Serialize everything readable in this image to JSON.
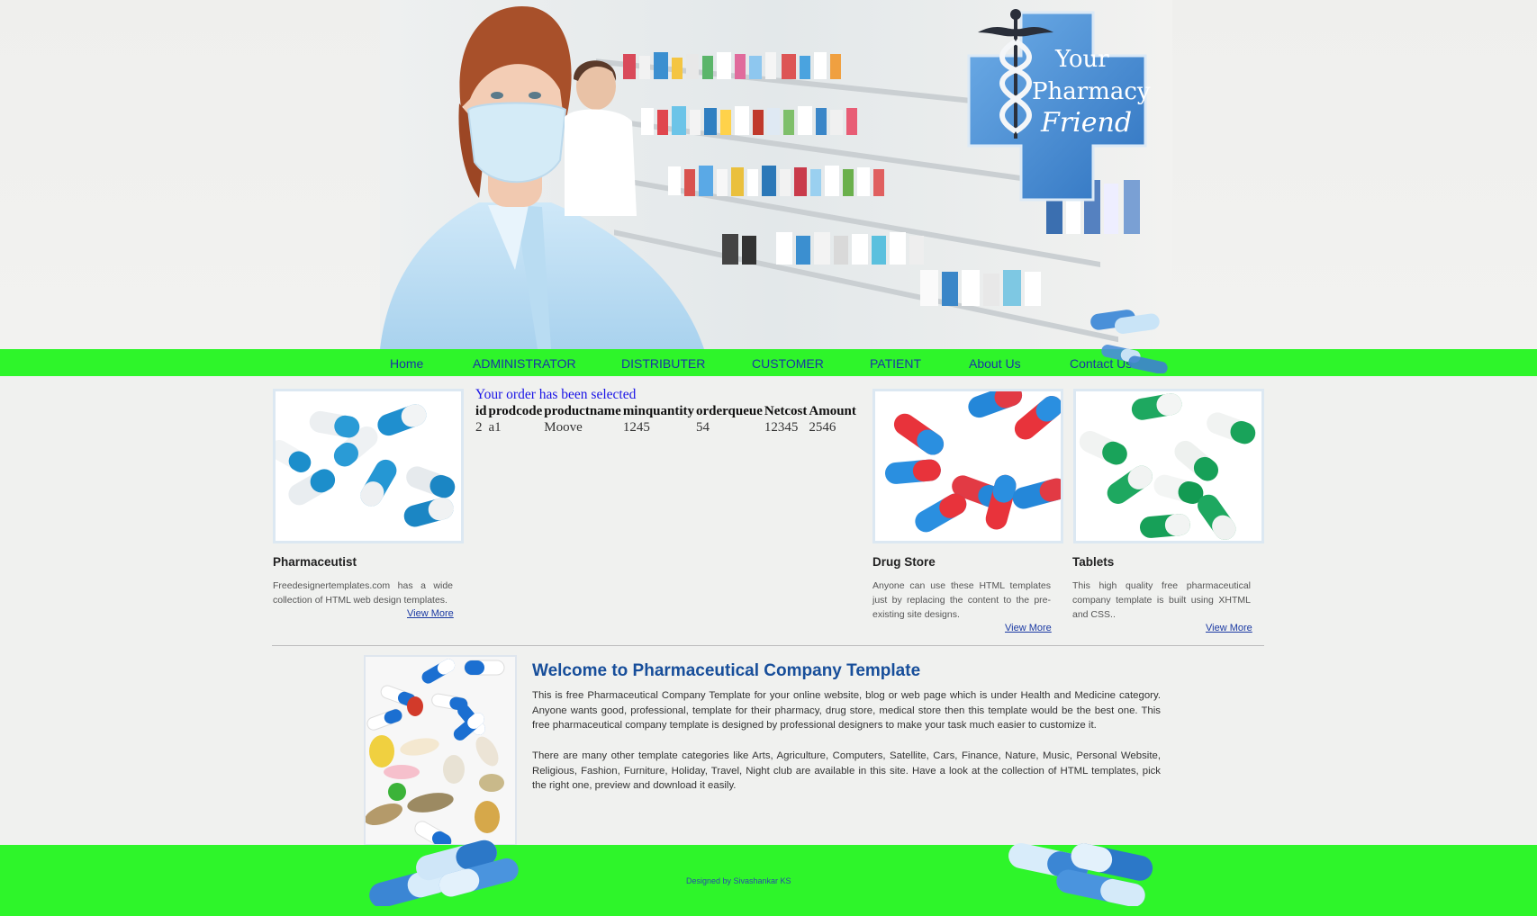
{
  "brand": {
    "logo_line1": "Your",
    "logo_line2": "Pharmacy",
    "logo_line3": "Friend"
  },
  "colors": {
    "accent_green": "#2ef52a",
    "nav_text": "#1a34a4",
    "heading_blue": "#174e9a",
    "order_msg": "#1a14e6"
  },
  "nav": {
    "items": [
      "Home",
      "ADMINISTRATOR",
      "DISTRIBUTER",
      "CUSTOMER",
      "PATIENT",
      "About Us",
      "Contact Us"
    ]
  },
  "cards": {
    "pharmaceutist": {
      "title": "Pharmaceutist",
      "text": "Freedesignertemplates.com has a wide collection of HTML web design templates.",
      "link": "View More"
    },
    "drugstore": {
      "title": "Drug Store",
      "text": "Anyone can use these HTML templates just by replacing the content to the pre-existing site designs.",
      "link": "View More"
    },
    "tablets": {
      "title": "Tablets",
      "text": "This high quality free pharmaceutical company template is built using XHTML and CSS..",
      "link": "View More"
    }
  },
  "order": {
    "message": "Your order has been selected",
    "headers": [
      "id",
      "prodcode",
      "productname",
      "minquantity",
      "orderqueue",
      "Netcost",
      "Amount"
    ],
    "rows": [
      [
        "2",
        "a1",
        "Moove",
        "1245",
        "54",
        "12345",
        "2546"
      ]
    ]
  },
  "welcome": {
    "title": "Welcome to Pharmaceutical Company Template",
    "para1": "This is free Pharmaceutical Company Template for your online website, blog or web page which is under Health and Medicine category. Anyone wants good, professional, template for their pharmacy, drug store, medical store then this template would be the best one. This free pharmaceutical company template is designed by professional designers to make your task much easier to customize it.",
    "para2": "There are many other template categories like Arts, Agriculture, Computers, Satellite, Cars, Finance, Nature, Music, Personal Website, Religious, Fashion, Furniture, Holiday, Travel, Night club are available in this site. Have a look at the collection of HTML templates, pick the right one, preview and download it easily."
  },
  "footer": {
    "credit": "Designed by Sivashankar KS"
  },
  "icons": [
    "caduceus-icon",
    "pill-icon"
  ]
}
